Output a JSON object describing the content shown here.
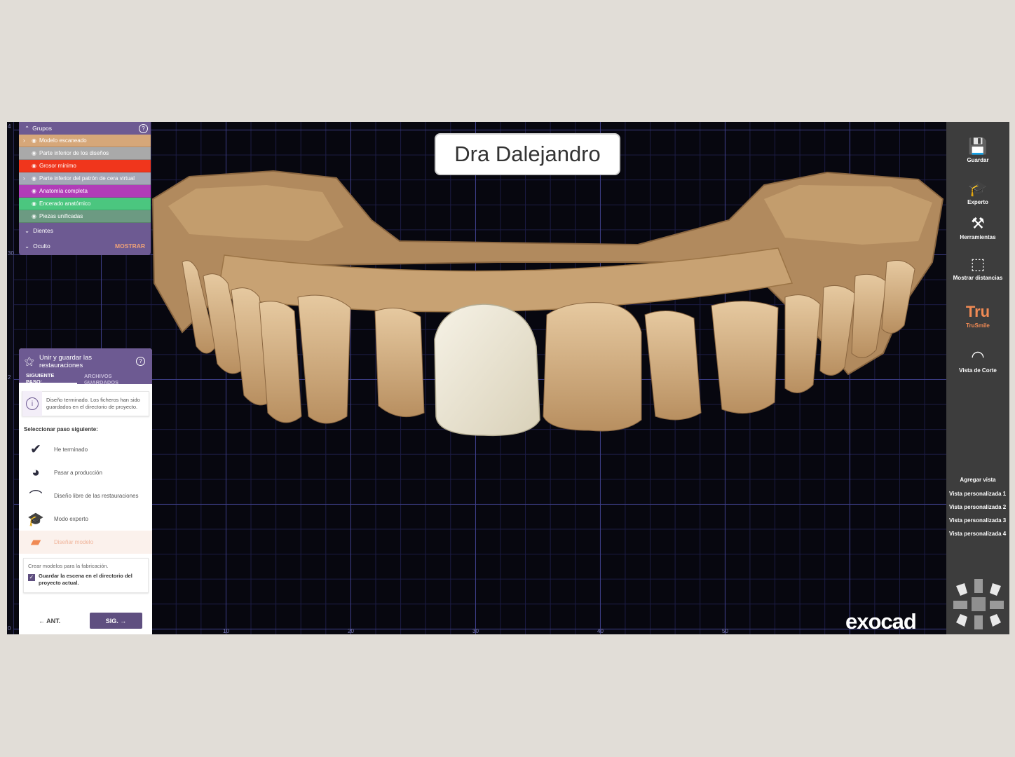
{
  "patient_label": "Dra Dalejandro",
  "logo": "exocad",
  "rulers": {
    "left": [
      "4",
      "30",
      "2",
      "0"
    ],
    "bottom": [
      "10",
      "20",
      "30",
      "40",
      "50"
    ]
  },
  "groups_panel": {
    "title": "Grupos",
    "items": [
      {
        "label": "Modelo escaneado",
        "color": "#d6a779",
        "expand": true
      },
      {
        "label": "Parte inferior de los diseños",
        "color": "#a9a9a9",
        "expand": false
      },
      {
        "label": "Grosor mínimo",
        "color": "#f0361c",
        "expand": false
      },
      {
        "label": "Parte inferior del patrón de cera virtual",
        "color": "#a4a7b7",
        "expand": true
      },
      {
        "label": "Anatomía completa",
        "color": "#b13cb8",
        "expand": false
      },
      {
        "label": "Encerado anatómico",
        "color": "#4bc67f",
        "expand": false
      },
      {
        "label": "Piezas unificadas",
        "color": "#6c9a82",
        "expand": false
      }
    ],
    "sections": [
      {
        "label": "Dientes"
      },
      {
        "label": "Oculto",
        "action": "MOSTRAR"
      }
    ]
  },
  "step_panel": {
    "title": "Unir y guardar las restauraciones",
    "tab_active": "SIGUIENTE PASO:",
    "tab_inactive": "ARCHIVOS GUARDADOS",
    "info_text": "Diseño terminado. Los ficheros han sido guardados en el directorio de proyecto.",
    "select_label": "Seleccionar paso siguiente:",
    "options": [
      {
        "label": "He terminado",
        "icon": "checkmark-icon"
      },
      {
        "label": "Pasar a producción",
        "icon": "mill-icon"
      },
      {
        "label": "Diseño libre de las restauraciones",
        "icon": "freeform-icon"
      },
      {
        "label": "Modo experto",
        "icon": "graduation-cap-icon"
      },
      {
        "label": "Diseñar modelo",
        "icon": "model-icon"
      }
    ],
    "box_text": "Crear modelos para la fabricación.",
    "checkbox_label": "Guardar la escena en el directorio del proyecto actual.",
    "prev_label": "ANT.",
    "next_label": "SIG."
  },
  "toolbar": {
    "tools": [
      {
        "label": "Guardar",
        "icon": "save-icon"
      },
      {
        "label": "Experto",
        "icon": "graduation-cap-icon"
      },
      {
        "label": "Herramientas",
        "icon": "tools-icon"
      },
      {
        "label": "Mostrar distancias",
        "icon": "distance-icon"
      },
      {
        "label": "TruSmile",
        "icon": "trusmile-icon",
        "badge": "Tru"
      },
      {
        "label": "Vista de Corte",
        "icon": "cut-view-icon"
      }
    ],
    "add_view": "Agregar vista",
    "views": [
      "Vista personalizada 1",
      "Vista personalizada 2",
      "Vista personalizada 3",
      "Vista personalizada 4"
    ]
  },
  "colors": {
    "panel": "#6d5a92",
    "accent": "#f08a54",
    "teeth": "#d6b58c",
    "crown": "#ece6d2",
    "grid": "#3c3d85"
  }
}
